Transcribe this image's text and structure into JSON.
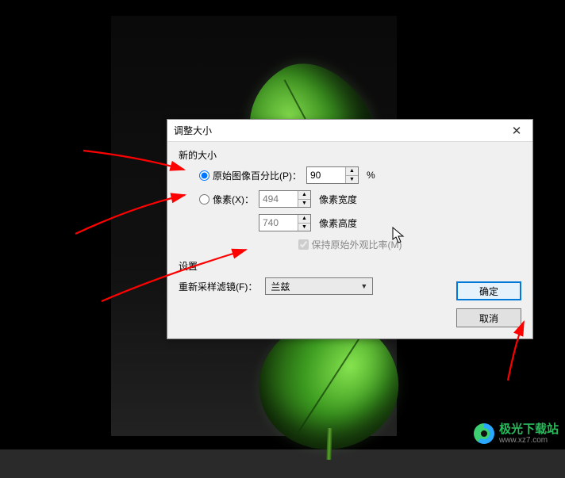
{
  "dialog": {
    "title": "调整大小",
    "group_new_size": "新的大小",
    "radio_percent_label": "原始图像百分比(P)：",
    "percent_value": "90",
    "percent_suffix": "%",
    "radio_pixels_label": "像素(X)：",
    "width_value": "494",
    "width_label": "像素宽度",
    "height_value": "740",
    "height_label": "像素高度",
    "preserve_ratio_label": "保持原始外观比率(M)",
    "settings_label": "设置",
    "filter_label": "重新采样滤镜(F)：",
    "filter_value": "兰兹",
    "ok_label": "确定",
    "cancel_label": "取消"
  },
  "watermark": {
    "line1": "极光下载站",
    "line2": "www.xz7.com"
  }
}
